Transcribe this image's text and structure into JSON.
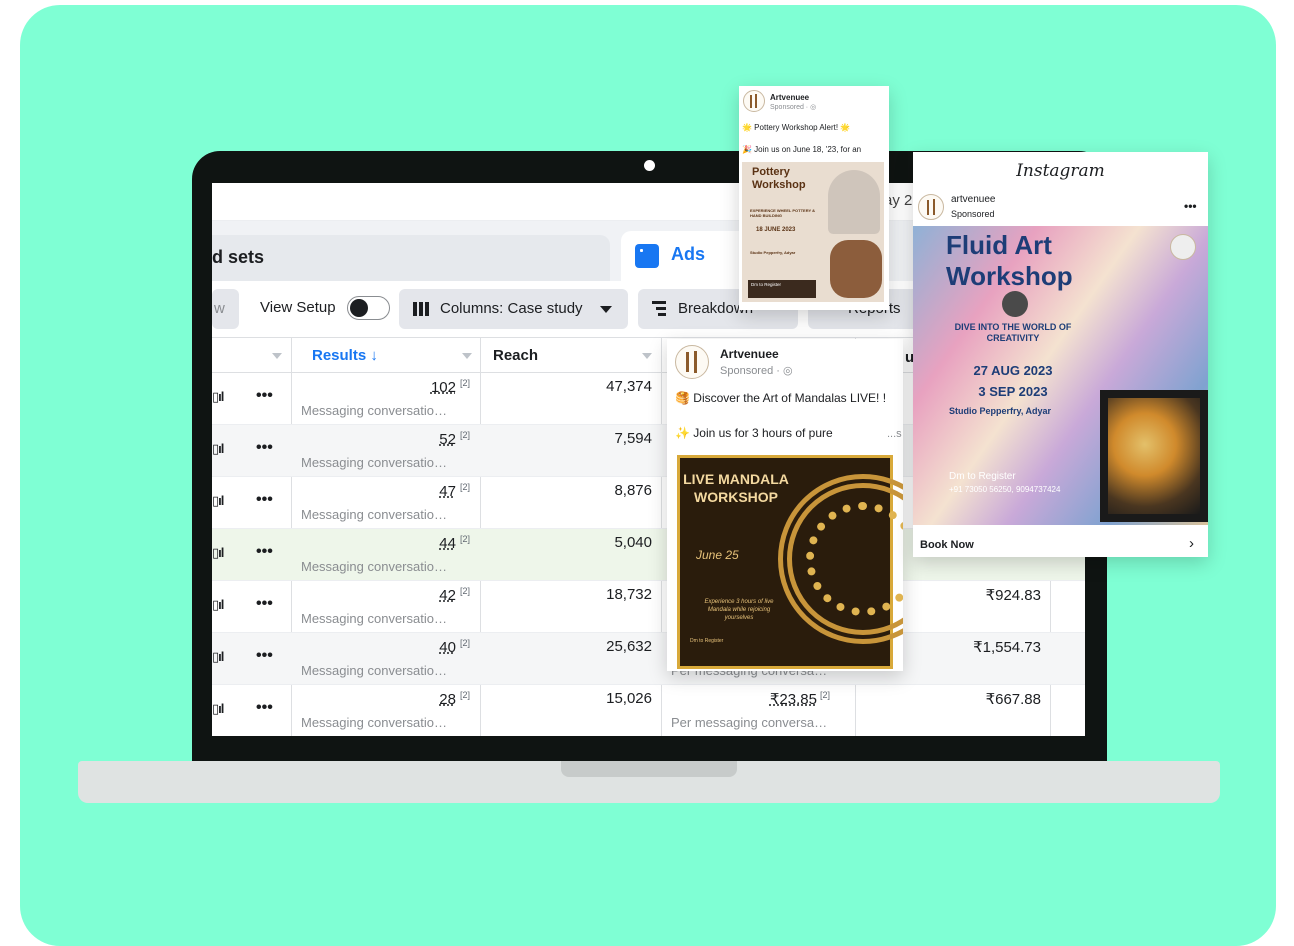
{
  "screen": {
    "top_date_partial": "ay 2",
    "tabs": {
      "ad_sets": "d sets",
      "ads": "Ads"
    },
    "toolbar": {
      "left_partial": "w",
      "view_setup": "View Setup",
      "columns": "Columns: Case study",
      "breakdown": "Breakdown",
      "reports": "Reports"
    },
    "table": {
      "headers": {
        "results": "Results ↓",
        "reach": "Reach",
        "partial": "ur"
      },
      "rows": [
        {
          "results": "102",
          "note": "[2]",
          "sub": "Messaging conversatio…",
          "reach": "47,374",
          "cpr": "",
          "cpr_sub": "",
          "cost": ""
        },
        {
          "results": "52",
          "note": "[2]",
          "sub": "Messaging conversatio…",
          "reach": "7,594",
          "cpr": "",
          "cpr_sub": "",
          "cost": ""
        },
        {
          "results": "47",
          "note": "[2]",
          "sub": "Messaging conversatio…",
          "reach": "8,876",
          "cpr": "",
          "cpr_sub": "",
          "cost": ""
        },
        {
          "results": "44",
          "note": "[2]",
          "sub": "Messaging conversatio…",
          "reach": "5,040",
          "cpr": "",
          "cpr_sub": "",
          "cost": ""
        },
        {
          "results": "42",
          "note": "[2]",
          "sub": "Messaging conversatio…",
          "reach": "18,732",
          "cpr": "",
          "cpr_sub": "",
          "cost": "₹924.83"
        },
        {
          "results": "40",
          "note": "[2]",
          "sub": "Messaging conversatio…",
          "reach": "25,632",
          "cpr": "",
          "cpr_sub": "Per messaging conversa…",
          "cost": "₹1,554.73"
        },
        {
          "results": "28",
          "note": "[2]",
          "sub": "Messaging conversatio…",
          "reach": "15,026",
          "cpr": "₹23.85",
          "cpr_sub": "Per messaging conversa…",
          "cost": "₹667.88"
        }
      ]
    }
  },
  "card_pottery": {
    "name": "Artvenuee",
    "sponsored": "Sponsored · ◎",
    "line1": "🌟 Pottery Workshop Alert! 🌟",
    "line2": "🎉 Join us on June 18, '23, for an",
    "poster_title": "Pottery Workshop",
    "poster_sub": "EXPERIENCE WHEEL POTTERY & HAND BUILDING",
    "poster_date": "18 JUNE 2023",
    "poster_place": "Studio Pepperfry, Adyar",
    "poster_dm": "Dm to Register"
  },
  "card_mandala": {
    "name": "Artvenuee",
    "sponsored": "Sponsored · ◎",
    "line1": "🥞 Discover the Art of Mandalas LIVE! !",
    "line2": "✨ Join us for 3 hours of pure",
    "more": "...s",
    "poster_title": "LIVE MANDALA WORKSHOP",
    "poster_date": "June 25",
    "poster_exp": "Experience 3 hours of live Mandala while rejoicing yourselves",
    "poster_dm": "Dm to Register"
  },
  "card_instagram": {
    "platform": "Instagram",
    "name": "artvenuee",
    "sponsored": "Sponsored",
    "poster_title": "Fluid Art Workshop",
    "poster_dive": "DIVE INTO THE WORLD OF CREATIVITY",
    "poster_date1": "27 AUG 2023",
    "poster_date2": "3 SEP 2023",
    "poster_place": "Studio Pepperfry, Adyar",
    "poster_dm": "Dm to Register",
    "poster_phone": "+91 73050 56250, 9094737424",
    "cta": "Book Now"
  }
}
